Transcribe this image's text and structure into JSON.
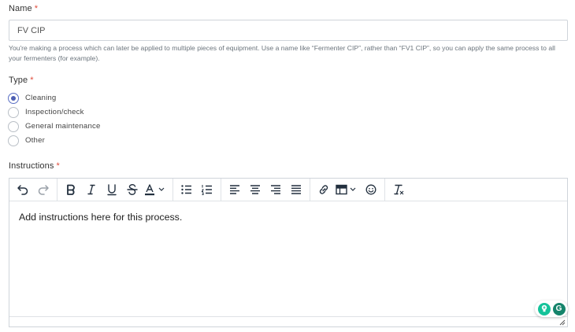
{
  "name_field": {
    "label": "Name",
    "required_mark": "*",
    "value": "FV CIP",
    "help_text": "You're making a process which can later be applied to multiple pieces of equipment. Use a name like “Fermenter CIP”, rather than “FV1 CIP”, so you can apply the same process to all your fermenters (for example)."
  },
  "type_field": {
    "label": "Type",
    "required_mark": "*",
    "options": [
      {
        "label": "Cleaning",
        "checked": true
      },
      {
        "label": "Inspection/check",
        "checked": false
      },
      {
        "label": "General maintenance",
        "checked": false
      },
      {
        "label": "Other",
        "checked": false
      }
    ]
  },
  "instructions_field": {
    "label": "Instructions",
    "required_mark": "*",
    "content": "Add instructions here for this process.",
    "toolbar_icons": [
      "undo-icon",
      "redo-icon",
      "bold-icon",
      "italic-icon",
      "underline-icon",
      "strikethrough-icon",
      "text-color-icon",
      "bullet-list-icon",
      "numbered-list-icon",
      "align-left-icon",
      "align-center-icon",
      "align-right-icon",
      "justify-icon",
      "link-icon",
      "table-icon",
      "emoji-icon",
      "clear-formatting-icon"
    ]
  },
  "grammarly": {
    "logo_letter": "G",
    "colors": {
      "bulb": "#15c39a",
      "logo": "#15846b"
    }
  },
  "colors": {
    "required": "#e04b3b",
    "radio_checked": "#4d5fb3",
    "border": "#cfd4da"
  }
}
